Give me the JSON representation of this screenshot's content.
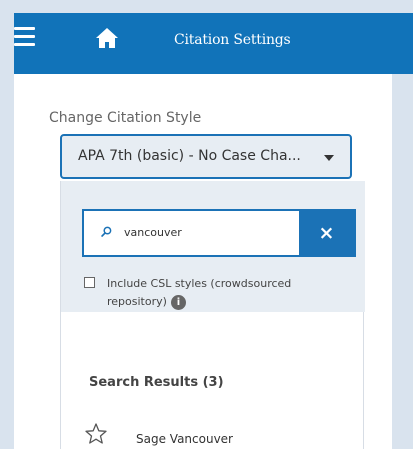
{
  "header": {
    "menu_icon": "hamburger-menu-icon",
    "home_icon": "home-icon",
    "title": "Citation Settings"
  },
  "style_section": {
    "label": "Change Citation Style",
    "selected_style": "APA 7th (basic) - No Case Cha..."
  },
  "search": {
    "value": "vancouver",
    "placeholder": "",
    "clear_icon": "close-icon",
    "clear_label": "×"
  },
  "csl_option": {
    "line_1": "Include CSL styles (crowdsourced",
    "line_2": "repository)",
    "info_label": "i"
  },
  "results": {
    "title": "Search Results (3)",
    "items": [
      {
        "label": "Sage Vancouver",
        "icon": "star-icon"
      }
    ]
  }
}
